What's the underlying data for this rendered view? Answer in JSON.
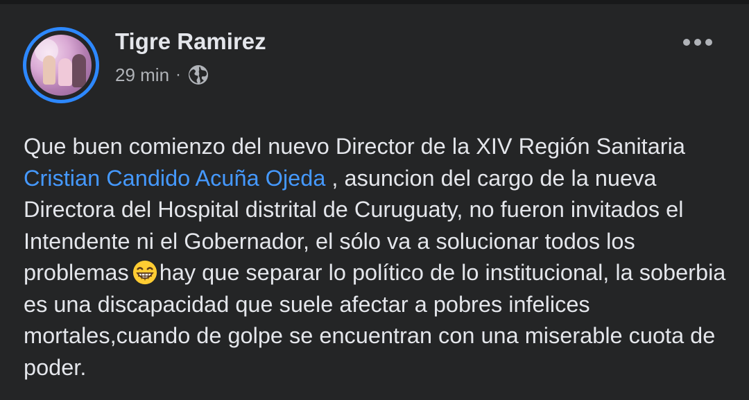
{
  "post": {
    "author": "Tigre Ramirez",
    "time": "29 min",
    "separator": "·",
    "privacy_icon": "globe-icon",
    "text_part1": "Que buen comienzo del nuevo Director de la XIV Región Sanitaria  ",
    "mention": "Cristian Candido Acuña Ojeda",
    "text_part2": " , asuncion del cargo de la nueva Directora del Hospital distrital de Curuguaty, no fueron invitados el Intendente ni el Gobernador, el sólo va a solucionar todos los problemas",
    "emoji": "😁",
    "text_part3": "hay que separar lo político de lo institucional, la soberbia es una discapacidad que suele afectar a pobres infelices mortales,cuando de golpe se encuentran con una miserable cuota de poder."
  },
  "colors": {
    "background": "#242526",
    "text": "#e4e6eb",
    "secondary_text": "#b0b3b8",
    "mention": "#4599ff",
    "story_ring": "#2d88ff"
  }
}
